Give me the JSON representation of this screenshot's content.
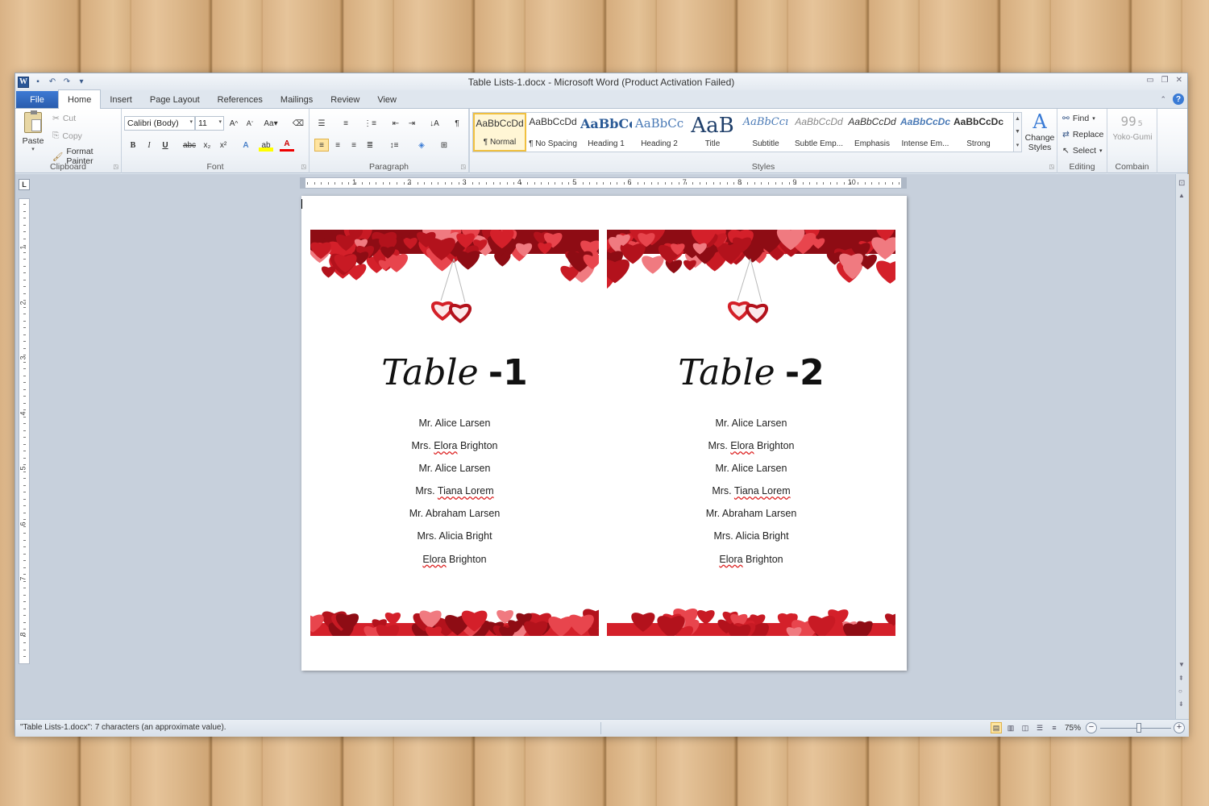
{
  "window": {
    "title": "Table Lists-1.docx - Microsoft Word (Product Activation Failed)"
  },
  "quick_access": {
    "app_icon": "word-icon",
    "items": [
      "save-icon",
      "undo-icon",
      "redo-icon",
      "customize-icon"
    ]
  },
  "tabs": [
    {
      "label": "File"
    },
    {
      "label": "Home",
      "active": true
    },
    {
      "label": "Insert"
    },
    {
      "label": "Page Layout"
    },
    {
      "label": "References"
    },
    {
      "label": "Mailings"
    },
    {
      "label": "Review"
    },
    {
      "label": "View"
    }
  ],
  "ribbon": {
    "clipboard": {
      "label": "Clipboard",
      "paste": "Paste",
      "cut": "Cut",
      "copy": "Copy",
      "format_painter": "Format Painter"
    },
    "font": {
      "label": "Font",
      "font_name": "Calibri (Body)",
      "font_size": "11"
    },
    "paragraph": {
      "label": "Paragraph"
    },
    "styles": {
      "label": "Styles",
      "items": [
        {
          "sample": "AaBbCcDd",
          "name": "¶ Normal"
        },
        {
          "sample": "AaBbCcDd",
          "name": "¶ No Spacing"
        },
        {
          "sample": "AaBbCc",
          "name": "Heading 1"
        },
        {
          "sample": "AaBbCc",
          "name": "Heading 2"
        },
        {
          "sample": "AaB",
          "name": "Title"
        },
        {
          "sample": "AaBbCcı",
          "name": "Subtitle"
        },
        {
          "sample": "AaBbCcDd",
          "name": "Subtle Emp..."
        },
        {
          "sample": "AaBbCcDd",
          "name": "Emphasis"
        },
        {
          "sample": "AaBbCcDc",
          "name": "Intense Em..."
        },
        {
          "sample": "AaBbCcDc",
          "name": "Strong"
        }
      ],
      "change_styles": "Change Styles"
    },
    "editing": {
      "label": "Editing",
      "find": "Find",
      "replace": "Replace",
      "select": "Select"
    },
    "combain": {
      "label": "Combain",
      "yoko": "Yoko-Gumi"
    }
  },
  "ruler": {
    "numbers": [
      "1",
      "2",
      "3",
      "4",
      "5",
      "6",
      "7",
      "8",
      "9",
      "10"
    ],
    "vnumbers": [
      "1",
      "2",
      "3",
      "4",
      "5",
      "6",
      "7",
      "8"
    ]
  },
  "document": {
    "cards": [
      {
        "title_word": "Table",
        "title_number": "-1",
        "names": [
          {
            "prefix": "Mr. ",
            "squiggle": "",
            "rest": "Alice Larsen"
          },
          {
            "prefix": "Mrs. ",
            "squiggle": "Elora",
            "rest": " Brighton"
          },
          {
            "prefix": "Mr. ",
            "squiggle": "",
            "rest": "Alice Larsen"
          },
          {
            "prefix": "Mrs. ",
            "squiggle": "Tiana Lorem",
            "rest": ""
          },
          {
            "prefix": "Mr. ",
            "squiggle": "",
            "rest": "Abraham Larsen"
          },
          {
            "prefix": "Mrs. ",
            "squiggle": "",
            "rest": "Alicia Bright"
          },
          {
            "prefix": "",
            "squiggle": "Elora",
            "rest": " Brighton"
          }
        ]
      },
      {
        "title_word": "Table",
        "title_number": "-2",
        "names": [
          {
            "prefix": "Mr. ",
            "squiggle": "",
            "rest": "Alice Larsen"
          },
          {
            "prefix": "Mrs. ",
            "squiggle": "Elora",
            "rest": " Brighton"
          },
          {
            "prefix": "Mr. ",
            "squiggle": "",
            "rest": "Alice Larsen"
          },
          {
            "prefix": "Mrs. ",
            "squiggle": "Tiana Lorem",
            "rest": ""
          },
          {
            "prefix": "Mr. ",
            "squiggle": "",
            "rest": "Abraham Larsen"
          },
          {
            "prefix": "Mrs. ",
            "squiggle": "",
            "rest": "Alicia Bright"
          },
          {
            "prefix": "",
            "squiggle": "Elora",
            "rest": " Brighton"
          }
        ]
      }
    ],
    "heart_colors": [
      "#b3121c",
      "#d4202a",
      "#e8454d",
      "#f07a80",
      "#8e0c14",
      "#c81a24"
    ]
  },
  "statusbar": {
    "text": "\"Table Lists-1.docx\": 7 characters (an approximate value).",
    "zoom": "75%",
    "zoom_fraction": 0.55
  }
}
